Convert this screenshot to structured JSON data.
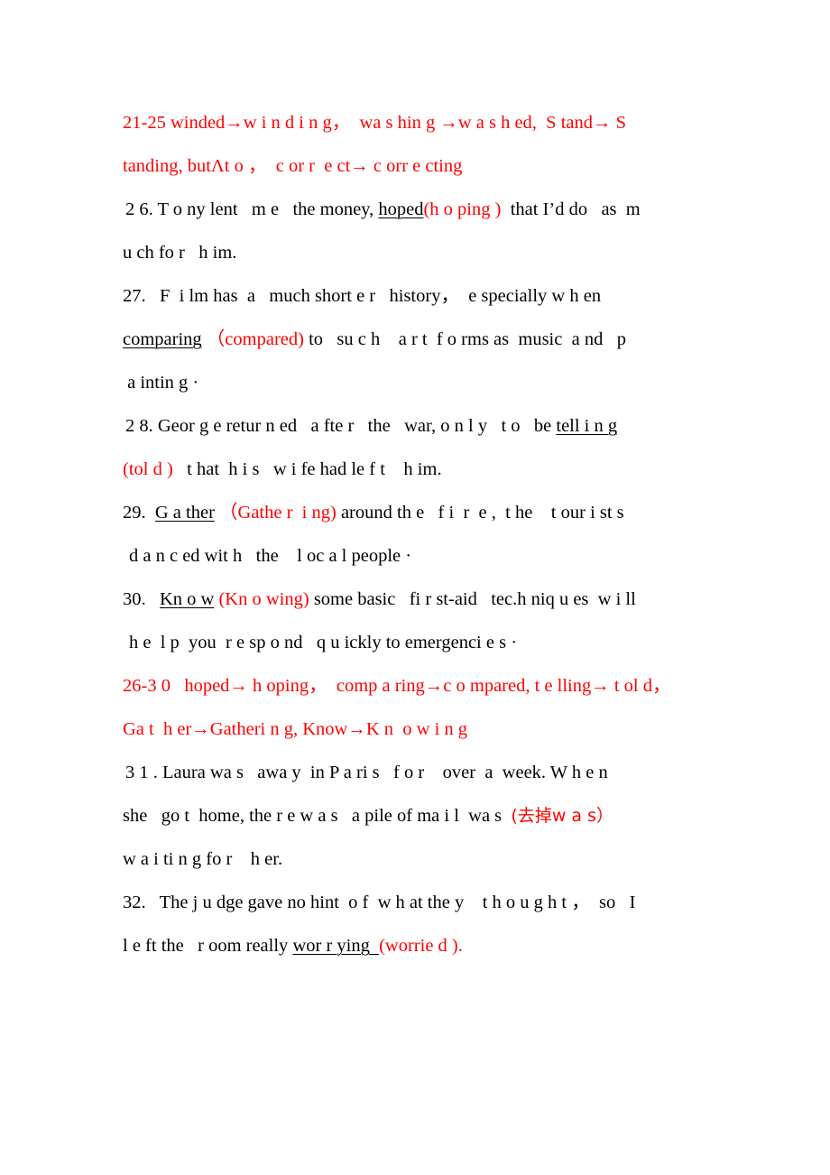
{
  "document": {
    "type": "grammar-correction-answer-key",
    "language": "English with Chinese annotations",
    "ink_colors": {
      "body_text": "#000000",
      "correction_red": "#ff0000",
      "underline": "#000000"
    },
    "page_background": "#ffffff"
  },
  "summary_21_25": {
    "line1": "21-25 winded→w i n d i n g，  wa s hin g →w a s h ed,  S tand→ S",
    "line2": "tanding, butΛt o ，  c or r  e ct→ c orr e cting"
  },
  "item26": {
    "number": "2 6. ",
    "pre": "T o ny lent   m e   the money, ",
    "error": "hoped",
    "correction": "(h o ping )",
    "post": "  that I’d do   as  m",
    "line2": "u ch fo r   h im."
  },
  "item27": {
    "line1": "27.   F  i lm has  a   much short e r   history，  e specially w h en",
    "error": "comparing",
    "correction": " （compared)",
    "post": " to   su c h    a r t  f o rms as  music  a nd   p",
    "line3": " a intin g ·"
  },
  "item28": {
    "line1_pre": "2 8. Geor g e retur n ed   a fte r   the   war, o n l y   t o   be ",
    "error": "tell i n g",
    "correction": "(tol d )",
    "line2_post": "   t hat  h i s   w i fe had le f t    h im."
  },
  "item29": {
    "number": "29.  ",
    "error": "G a ther",
    "correction": " （Gathe r  i ng)",
    "post": " around th e   f i  r  e ,  t he    t our i st s",
    "line2": "d a n c ed wit h   the    l oc a l people ·"
  },
  "item30": {
    "number": "30.   ",
    "error": "Kn o w",
    "correction": " (Kn o wing)",
    "post": " some basic   fi r st-aid   tec.h niq u es  w i ll",
    "line2": "h e  l p  you  r e sp o nd   q u ickly to emergenci e s ·"
  },
  "summary_26_30": {
    "line1": "26-3 0   hoped→ h oping，  comp a ring→c o mpared, t e lling→ t ol d，",
    "line2": "Ga t  h er→Gatheri n g, Know→K n  o w i n g"
  },
  "item31": {
    "line1": "3 1 . Laura wa s   awa y  in P a ri s   f o r    over  a  week. W h e n",
    "line2_pre": "she   go t  home, the r e w a s   a pile of ma i l  wa s  ",
    "line2_note": "(去掉w a s）",
    "line3": "w a i ti n g fo r    h er."
  },
  "item32": {
    "line1": "32.   The j u dge gave no hint  o f  w h at the y    t h o u g h t ，  so   I",
    "line2_pre": "l e ft the   r oom really ",
    "error": "wor r ying  ",
    "correction": "(worrie d ).",
    "line2_gap": ""
  }
}
